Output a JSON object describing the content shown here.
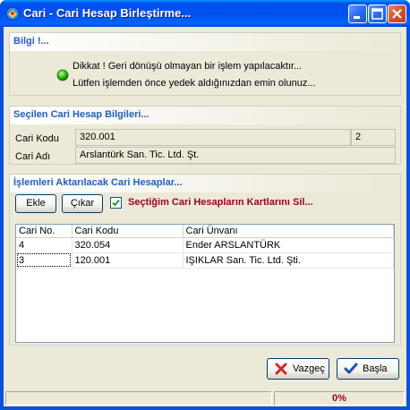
{
  "window": {
    "title": "Cari - Cari Hesap Birleştirme..."
  },
  "info": {
    "header": "Bilgi !...",
    "line1": "Dikkat !  Geri dönüşü olmayan bir işlem yapılacaktır...",
    "line2": "Lütfen işlemden önce yedek aldığınızdan emin olunuz..."
  },
  "selected": {
    "header": "Seçilen Cari Hesap Bilgileri...",
    "code_label": "Cari Kodu",
    "code_value": "320.001",
    "code_extra": "2",
    "name_label": "Cari Adı",
    "name_value": "Arslantürk San. Tic. Ltd. Şt."
  },
  "transfer": {
    "header": "İşlemleri Aktarılacak Cari Hesaplar...",
    "add_label": "Ekle",
    "remove_label": "Çıkar",
    "delete_cards_label": "Seçtiğim Cari Hesapların Kartlarını Sil...",
    "delete_cards_checked": true,
    "columns": [
      "Cari No.",
      "Cari Kodu",
      "Cari Ünvanı"
    ],
    "rows": [
      [
        "4",
        "320.054",
        "Ender ARSLANTÜRK"
      ],
      [
        "3",
        "120.001",
        "IŞIKLAR San. Tic. Ltd. Şti."
      ]
    ]
  },
  "footer": {
    "cancel_label": "Vazgeç",
    "start_label": "Başla",
    "progress": "0%"
  }
}
